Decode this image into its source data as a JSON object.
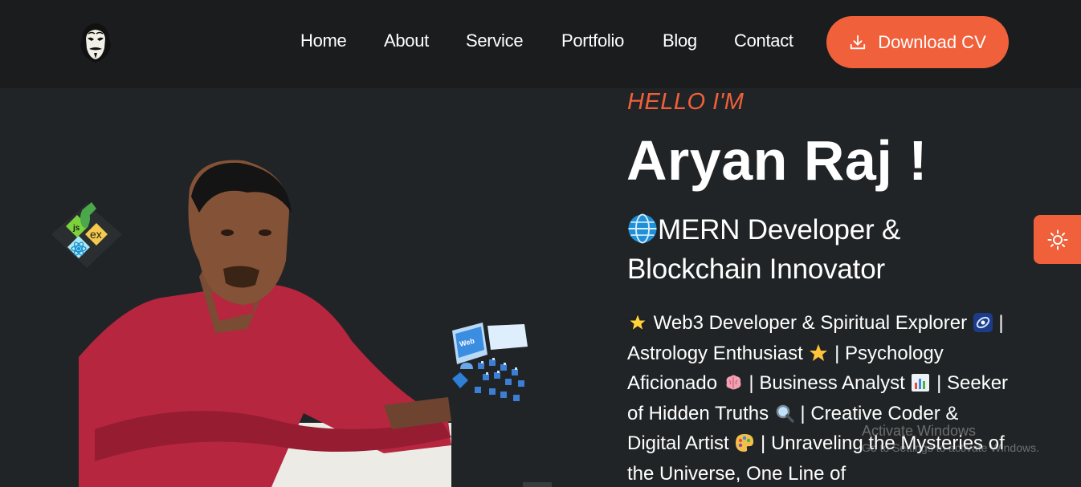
{
  "nav": {
    "logo_icon": "anonymous-mask-icon",
    "links": [
      {
        "label": "Home"
      },
      {
        "label": "About"
      },
      {
        "label": "Service"
      },
      {
        "label": "Portfolio"
      },
      {
        "label": "Blog"
      },
      {
        "label": "Contact"
      }
    ],
    "download_label": "Download CV",
    "download_icon": "download-icon"
  },
  "hero": {
    "greeting": "HELLO I'M",
    "name": "Aryan Raj !",
    "role_icon": "globe-icon",
    "role": "MERN Developer & Blockchain Innovator",
    "bio": [
      {
        "icon": "star-icon",
        "text": " Web3 Developer & Spiritual Explorer "
      },
      {
        "icon": "galaxy-icon",
        "text": " | Astrology Enthusiast "
      },
      {
        "icon": "star-icon",
        "text": " | Psychology Aficionado "
      },
      {
        "icon": "brain-icon",
        "text": " | Business Analyst "
      },
      {
        "icon": "bar-chart-icon",
        "text": " | Seeker of Hidden Truths "
      },
      {
        "icon": "magnifier-icon",
        "text": " | Creative Coder & Digital Artist "
      },
      {
        "icon": "palette-icon",
        "text": " | Unraveling the Mysteries of the Universe, One Line of"
      }
    ],
    "badge_labels": {
      "js": "js",
      "ex": "ex"
    },
    "web_label": "Web"
  },
  "theme_toggle_icon": "sun-icon",
  "watermark": {
    "title": "Activate Windows",
    "subtitle": "Go to Settings to activate Windows."
  },
  "colors": {
    "accent": "#f0603a",
    "background": "#212426",
    "navbar": "#1b1c1e"
  }
}
